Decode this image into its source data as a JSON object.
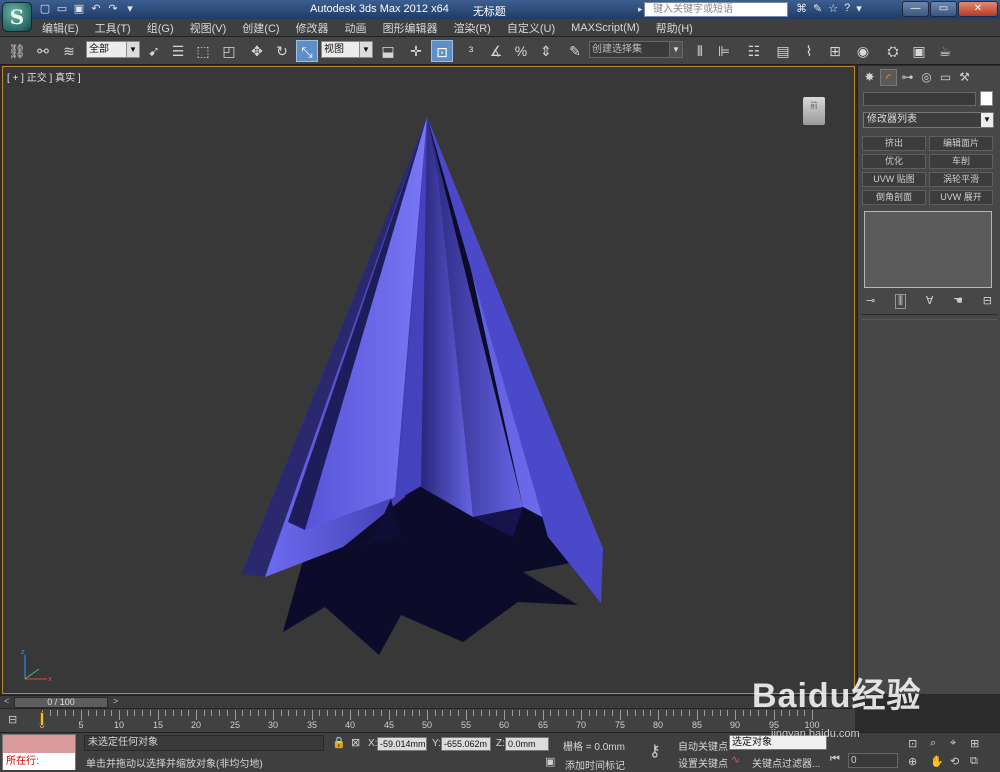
{
  "title_bar": {
    "app_title": "Autodesk 3ds Max  2012 x64",
    "doc_title": "无标题",
    "search_placeholder": "键入关键字或短语",
    "window_buttons": [
      "minimize",
      "maximize",
      "close"
    ]
  },
  "menu": {
    "items": [
      "编辑(E)",
      "工具(T)",
      "组(G)",
      "视图(V)",
      "创建(C)",
      "修改器",
      "动画",
      "图形编辑器",
      "渲染(R)",
      "自定义(U)",
      "MAXScript(M)",
      "帮助(H)"
    ]
  },
  "toolbar": {
    "selection_filter": "全部",
    "reference_coord": "视图",
    "named_selection": "创建选择集"
  },
  "viewport": {
    "label": "[ + ] 正交 ] 真实 ]",
    "viewcube_label": "前",
    "object_color": "#5a57d6",
    "background_color": "#383838",
    "active_border_color": "#b8892d"
  },
  "command_panel": {
    "modifier_list": "修改器列表",
    "modifier_buttons": [
      "挤出",
      "编辑面片",
      "优化",
      "车削",
      "UVW 贴图",
      "涡轮平滑",
      "倒角剖面",
      "UVW 展开"
    ]
  },
  "timeline": {
    "slider_label": "0 / 100",
    "ruler_labels": [
      "0",
      "5",
      "10",
      "15",
      "20",
      "25",
      "30",
      "35",
      "40",
      "45",
      "50",
      "55",
      "60",
      "65",
      "70",
      "75",
      "80",
      "85",
      "90",
      "95",
      "100"
    ]
  },
  "status": {
    "maxscript_label": "所在行:",
    "selection_status": "未选定任何对象",
    "prompt": "单击并拖动以选择并缩放对象(非均匀地)",
    "x_label": "X:",
    "x_value": "-59.014mm",
    "y_label": "Y:",
    "y_value": "-655.062m",
    "z_label": "Z:",
    "z_value": "0.0mm",
    "grid": "栅格 = 0.0mm",
    "add_time_tag": "添加时间标记",
    "auto_key": "自动关键点",
    "set_key": "设置关键点",
    "selected_object": "选定对象",
    "key_filters": "关键点过滤器...",
    "current_frame": "0"
  },
  "watermark": {
    "brand": "Baidu经验",
    "url": "jingyan.baidu.com"
  }
}
